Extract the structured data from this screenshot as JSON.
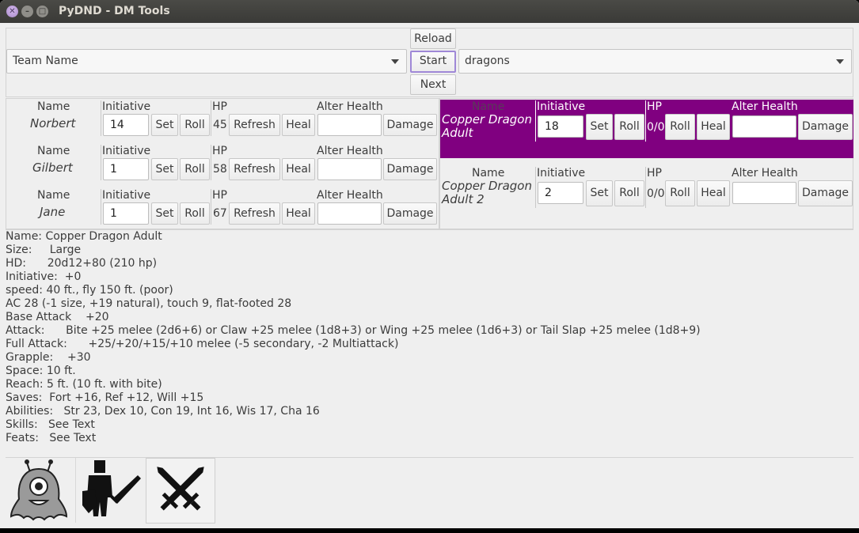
{
  "window": {
    "title": "PyDND - DM Tools"
  },
  "toolbar": {
    "reload_label": "Reload",
    "start_label": "Start",
    "next_label": "Next",
    "team_select": "Team Name",
    "monster_select": "dragons"
  },
  "headers": {
    "name": "Name",
    "initiative": "Initiative",
    "hp": "HP",
    "alter_health": "Alter Health"
  },
  "buttons": {
    "set": "Set",
    "roll": "Roll",
    "refresh": "Refresh",
    "heal": "Heal",
    "damage": "Damage"
  },
  "players": [
    {
      "name": "Norbert",
      "initiative": "14",
      "hp": "45"
    },
    {
      "name": "Gilbert",
      "initiative": "1",
      "hp": "58"
    },
    {
      "name": "Jane",
      "initiative": "1",
      "hp": "67"
    }
  ],
  "monsters": [
    {
      "name_line1": "Copper Dragon",
      "name_line2": "Adult",
      "initiative": "18",
      "hp": "0/0",
      "active": true,
      "highlight_color": "#800080"
    },
    {
      "name_line1": "Copper Dragon",
      "name_line2": "Adult 2",
      "initiative": "2",
      "hp": "0/0",
      "active": false
    }
  ],
  "stats": [
    "Name: Copper Dragon Adult",
    "Size:     Large",
    "HD:      20d12+80 (210 hp)",
    "Initiative:  +0",
    "speed: 40 ft., fly 150 ft. (poor)",
    "AC 28 (-1 size, +19 natural), touch 9, flat-footed 28",
    "Base Attack    +20",
    "Attack:      Bite +25 melee (2d6+6) or Claw +25 melee (1d8+3) or Wing +25 melee (1d6+3) or Tail Slap +25 melee (1d8+9)",
    "Full Attack:      +25/+20/+15/+10 melee (-5 secondary, -2 Multiattack)",
    "Grapple:    +30",
    "Space: 10 ft.",
    "Reach: 5 ft. (10 ft. with bite)",
    "Saves:  Fort +16, Ref +12, Will +15",
    "Abilities:   Str 23, Dex 10, Con 19, Int 16, Wis 17, Cha 16",
    "Skills:   See Text",
    "Feats:   See Text"
  ],
  "tools": [
    {
      "icon": "monster-icon"
    },
    {
      "icon": "knight-icon"
    },
    {
      "icon": "crossed-swords-icon"
    }
  ],
  "colors": {
    "highlight": "#800080",
    "titlebar": "#3c3b37",
    "focus_border": "#9f88d7"
  }
}
